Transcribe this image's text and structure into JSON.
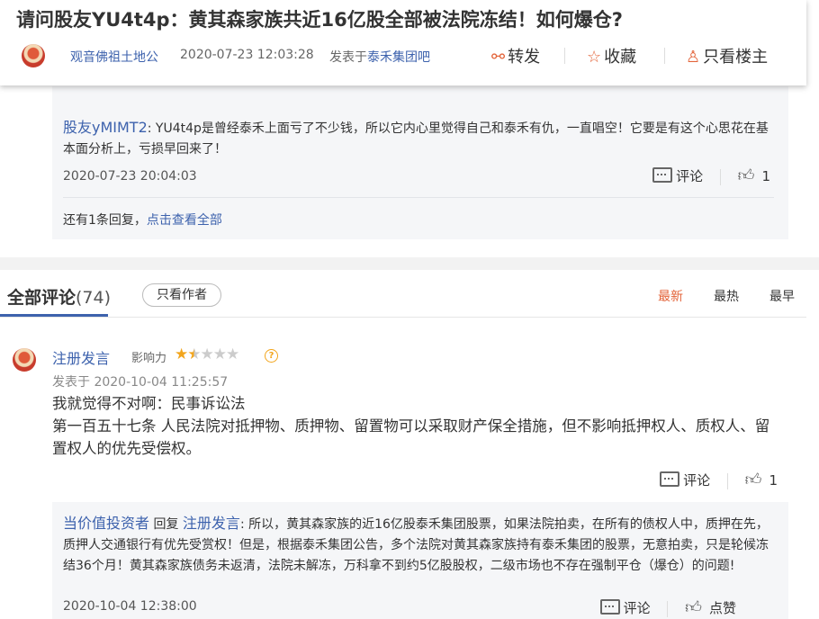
{
  "header": {
    "title": "请问股友YU4t4p：黄其森家族共近16亿股全部被法院冻结！如何爆仓?",
    "author": "观音佛祖土地公",
    "time": "2020-07-23 12:03:28",
    "posted_prefix": "发表于",
    "forum": "泰禾集团吧",
    "share": "转发",
    "favorite": "收藏",
    "owner_only": "只看楼主",
    "share_icon": "share-icon",
    "favorite_icon": "star-icon",
    "owner_icon": "user-icon"
  },
  "reply_box": {
    "name": "股友yMIMT2",
    "text": ": YU4t4p是曾经泰禾上面亏了不少钱，所以它内心里觉得自己和泰禾有仇，一直唱空！它要是有这个心思花在基本面分析上，亏损早回来了！",
    "time": "2020-07-23 20:04:03",
    "comment_label": "评论",
    "like_count": "1",
    "more_prefix": "还有1条回复，",
    "more_link": "点击查看全部"
  },
  "tabs": {
    "all_label": "全部评论",
    "count": "(74)",
    "only_author": "只看作者",
    "sort": [
      "最新",
      "最热",
      "最早"
    ]
  },
  "comment": {
    "name": "注册发言",
    "influence_label": "影响力",
    "rating": 1.5,
    "rating_max": 5,
    "time": "发表于 2020-10-04 11:25:57",
    "line1": "我就觉得不对啊：民事诉讼法",
    "line2": "第一百五十七条 人民法院对抵押物、质押物、留置物可以采取财产保全措施，但不影响抵押权人、质权人、留置权人的优先受偿权。",
    "comment_label": "评论",
    "like_count": "1"
  },
  "sub_reply": {
    "name": "当价值投资者",
    "reply_word": "回复",
    "target": "注册发言",
    "text": ": 所以，黄其森家族的近16亿股泰禾集团股票，如果法院拍卖，在所有的债权人中，质押在先，质押人交通银行有优先受赏权！但是，根据泰禾集团公告，多个法院对黄其森家族持有泰禾集团的股票，无意拍卖，只是轮候冻结36个月！黄其森家族债务未返清，法院未解冻，万科拿不到约5亿股股权，二级市场也不存在强制平仓（爆仓）的问题!",
    "time": "2020-10-04 12:38:00",
    "comment_label": "评论",
    "like_label": "点赞"
  },
  "colors": {
    "link_blue": "#3d62ad",
    "accent_orange": "#e3643a",
    "star_gold": "#f2a51c"
  }
}
